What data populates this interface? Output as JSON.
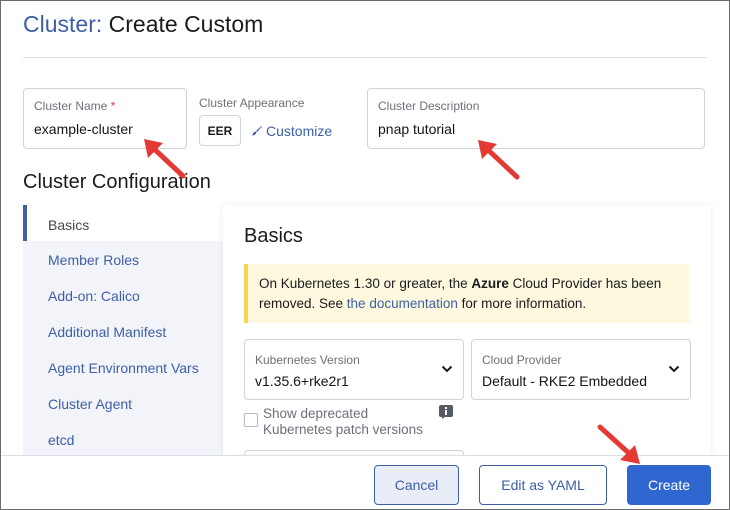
{
  "page": {
    "title_prefix": "Cluster:",
    "title_rest": "Create Custom"
  },
  "form": {
    "cluster_name": {
      "label": "Cluster Name",
      "required_mark": "*",
      "value": "example-cluster"
    },
    "appearance": {
      "label": "Cluster Appearance",
      "badge": "EER",
      "customize_label": "Customize"
    },
    "description": {
      "label": "Cluster Description",
      "value": "pnap tutorial"
    }
  },
  "config": {
    "section_title": "Cluster Configuration",
    "nav": [
      {
        "label": "Basics",
        "active": true
      },
      {
        "label": "Member Roles",
        "active": false
      },
      {
        "label": "Add-on: Calico",
        "active": false
      },
      {
        "label": "Additional Manifest",
        "active": false
      },
      {
        "label": "Agent Environment Vars",
        "active": false
      },
      {
        "label": "Cluster Agent",
        "active": false
      },
      {
        "label": "etcd",
        "active": false
      }
    ],
    "panel_title": "Basics",
    "banner": {
      "text_before": "On Kubernetes 1.30 or greater, the ",
      "bold": "Azure",
      "text_middle": " Cloud Provider has been removed. See ",
      "link": "the documentation",
      "text_after": " for more information."
    },
    "k8s_version": {
      "label": "Kubernetes Version",
      "value": "v1.35.6+rke2r1"
    },
    "cloud_provider": {
      "label": "Cloud Provider",
      "value": "Default - RKE2 Embedded"
    },
    "show_deprecated": {
      "line1": "Show deprecated",
      "line2": "Kubernetes patch versions",
      "checked": false
    }
  },
  "footer": {
    "cancel": "Cancel",
    "edit_yaml": "Edit as YAML",
    "create": "Create"
  },
  "colors": {
    "accent": "#3d5fa6",
    "primary_button": "#2f66d0",
    "annotation_arrow": "#e53935",
    "banner_bg": "#fdf8de"
  }
}
